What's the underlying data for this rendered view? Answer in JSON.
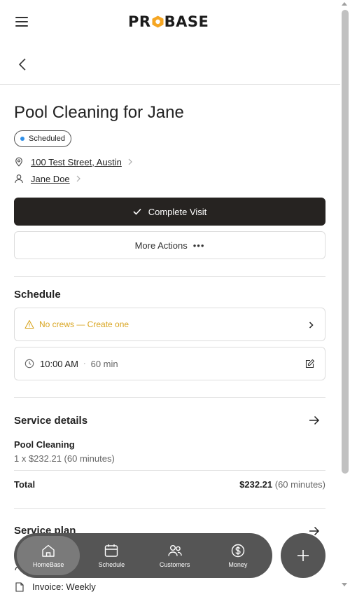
{
  "header": {
    "logo": {
      "left": "PR",
      "right": "BASE",
      "accent": "#f5a623"
    }
  },
  "visit": {
    "title": "Pool Cleaning for Jane",
    "status": "Scheduled",
    "status_color": "#2f8fe8",
    "address": "100 Test Street, Austin",
    "customer": "Jane Doe"
  },
  "actions": {
    "complete_label": "Complete Visit",
    "more_label": "More Actions",
    "more_dots": "•••"
  },
  "schedule": {
    "title": "Schedule",
    "crew_warning": "No crews — Create one",
    "warning_color": "#d9a520",
    "time": "10:00 AM",
    "separator": "·",
    "duration": "60 min"
  },
  "service_details": {
    "title": "Service details",
    "item_name": "Pool Cleaning",
    "item_price": "1 x $232.21 (60 minutes)",
    "total_label": "Total",
    "total_amount": "$232.21",
    "total_minutes": "(60 minutes)"
  },
  "service_plan": {
    "title": "Service plan",
    "invoice": "Invoice: Weekly"
  },
  "nav": {
    "items": [
      {
        "label": "HomeBase",
        "icon": "home-icon"
      },
      {
        "label": "Schedule",
        "icon": "calendar-icon"
      },
      {
        "label": "Customers",
        "icon": "users-icon"
      },
      {
        "label": "Money",
        "icon": "dollar-icon"
      }
    ],
    "fab_icon": "plus-icon"
  }
}
